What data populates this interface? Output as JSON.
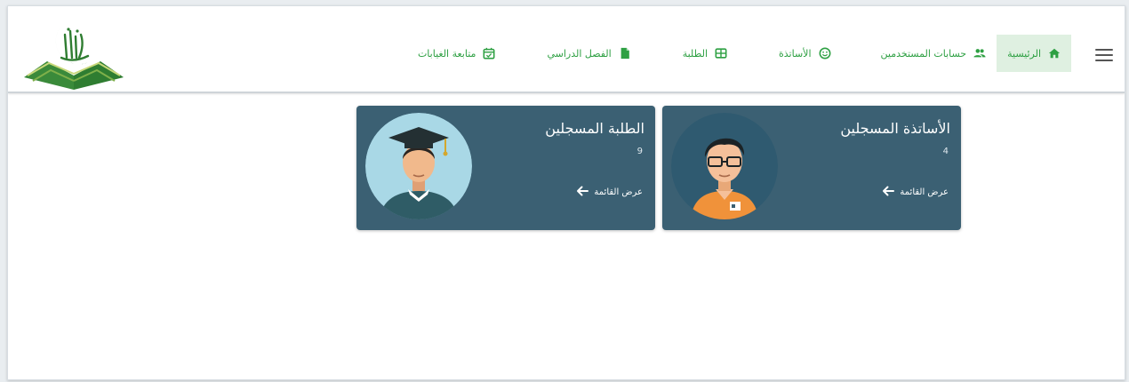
{
  "nav": {
    "items": [
      {
        "label": "الرئيسية",
        "icon": "home-icon",
        "active": true
      },
      {
        "label": "حسابات المستخدمين",
        "icon": "users-icon"
      },
      {
        "label": "الأساتذة",
        "icon": "smiley-icon"
      },
      {
        "label": "الطلبة",
        "icon": "grid-icon"
      },
      {
        "label": "الفصل الدراسي",
        "icon": "document-icon"
      },
      {
        "label": "متابعة الغيابات",
        "icon": "calendar-check-icon"
      }
    ],
    "menu_icon": "hamburger-icon"
  },
  "logo": {
    "icon": "book-logo-icon"
  },
  "cards": [
    {
      "title": "الأساتذة المسجلين",
      "count": "4",
      "link": "عرض القائمة",
      "avatar": "teacher-avatar"
    },
    {
      "title": "الطلبة المسجلين",
      "count": "9",
      "link": "عرض القائمة",
      "avatar": "student-avatar"
    }
  ],
  "colors": {
    "accent": "#2ea043",
    "card_bg": "#3b6073",
    "active_nav_bg": "#dff0e1"
  }
}
